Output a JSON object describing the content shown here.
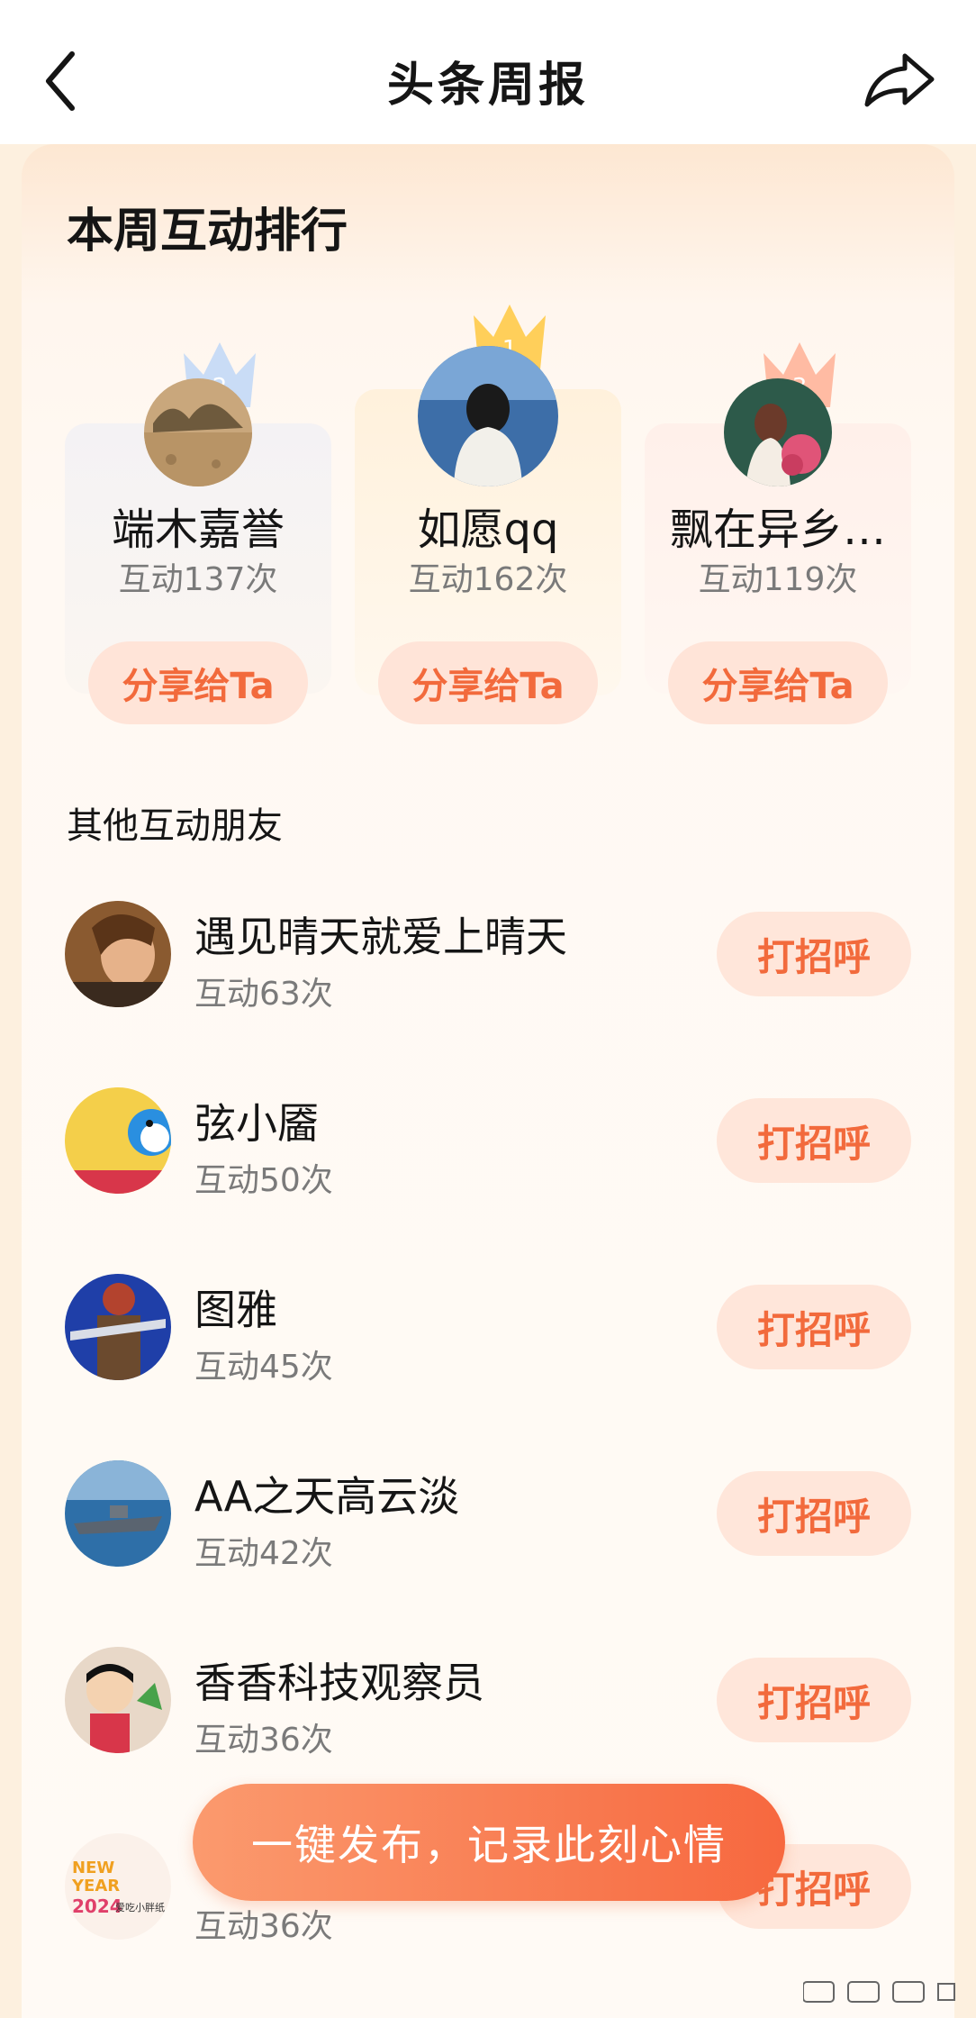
{
  "header": {
    "title": "头条周报"
  },
  "ranking": {
    "title": "本周互动排行",
    "top": [
      {
        "rank": "2",
        "name": "端木嘉誉",
        "count": "互动137次",
        "share_label": "分享给Ta"
      },
      {
        "rank": "1",
        "name": "如愿qq",
        "count": "互动162次",
        "share_label": "分享给Ta"
      },
      {
        "rank": "3",
        "name": "飘在异乡…",
        "count": "互动119次",
        "share_label": "分享给Ta"
      }
    ]
  },
  "others": {
    "title": "其他互动朋友",
    "greet_label": "打招呼",
    "items": [
      {
        "name": "遇见晴天就爱上晴天",
        "count": "互动63次"
      },
      {
        "name": "弦小靥",
        "count": "互动50次"
      },
      {
        "name": "图雅",
        "count": "互动45次"
      },
      {
        "name": "AA之天高云淡",
        "count": "互动42次"
      },
      {
        "name": "香香科技观察员",
        "count": "互动36次"
      },
      {
        "name": "",
        "count": "互动36次",
        "avatar_text_1": "NEW",
        "avatar_text_2": "YEAR",
        "avatar_text_3": "2024",
        "avatar_text_4": "爱吃小胖纸"
      }
    ]
  },
  "publish": {
    "label": "一键发布，记录此刻心情"
  },
  "colors": {
    "accent": "#f26a3c",
    "button_bg": "#ffe6da",
    "gold": "#ffcf5a",
    "silver": "#bcd4f5",
    "bronze": "#ffb49a"
  },
  "icons": [
    "back-icon",
    "share-icon",
    "crown-icon"
  ]
}
